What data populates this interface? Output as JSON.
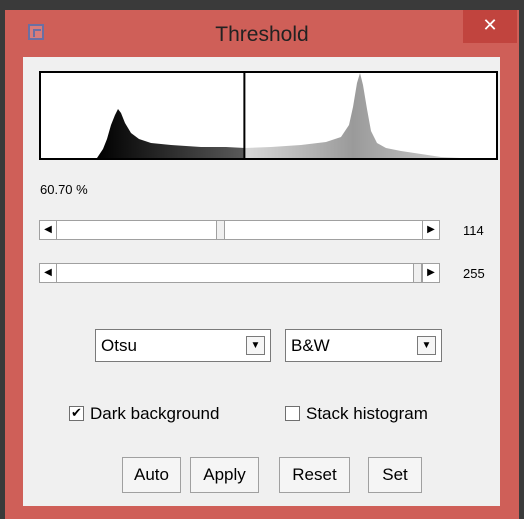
{
  "window": {
    "title": "Threshold",
    "close_glyph": "✕",
    "app_icon": "imagej-icon"
  },
  "histogram": {
    "threshold_fraction": 0.447
  },
  "percent_label": "60.70 %",
  "sliders": [
    {
      "value_label": "114",
      "value": 114,
      "max": 255,
      "left_arrow": "◀",
      "right_arrow": "▶"
    },
    {
      "value_label": "255",
      "value": 255,
      "max": 255,
      "left_arrow": "◀",
      "right_arrow": "▶"
    }
  ],
  "method_select": {
    "value": "Otsu",
    "arrow": "▼"
  },
  "display_select": {
    "value": "B&W",
    "arrow": "▼"
  },
  "checkboxes": [
    {
      "label": "Dark background",
      "checked": true,
      "mark": "✔"
    },
    {
      "label": "Stack histogram",
      "checked": false,
      "mark": ""
    }
  ],
  "buttons": {
    "auto": "Auto",
    "apply": "Apply",
    "reset": "Reset",
    "set": "Set"
  },
  "colors": {
    "title_bar": "#cf5f58",
    "close_bg": "#c1443e",
    "client_bg": "#f0f0f0"
  }
}
